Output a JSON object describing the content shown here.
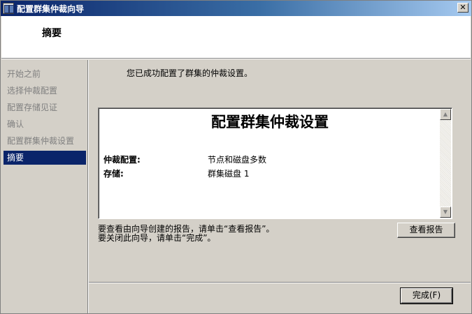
{
  "window": {
    "title": "配置群集仲裁向导",
    "close_glyph": "✕"
  },
  "header": {
    "title": "摘要"
  },
  "sidebar": {
    "items": [
      {
        "label": "开始之前",
        "active": false
      },
      {
        "label": "选择仲裁配置",
        "active": false
      },
      {
        "label": "配置存储见证",
        "active": false
      },
      {
        "label": "确认",
        "active": false
      },
      {
        "label": "配置群集仲裁设置",
        "active": false
      },
      {
        "label": "摘要",
        "active": true
      }
    ]
  },
  "main": {
    "intro": "您已成功配置了群集的仲裁设置。",
    "report": {
      "title": "配置群集仲裁设置",
      "rows": [
        {
          "label": "仲裁配置:",
          "value": "节点和磁盘多数"
        },
        {
          "label": "存储:",
          "value": "群集磁盘 1"
        }
      ]
    },
    "hint_line1": "要查看由向导创建的报告，请单击“查看报告”。",
    "hint_line2": "要关闭此向导，请单击“完成”。",
    "view_report_button": "查看报告",
    "finish_button": "完成(F)"
  },
  "icons": {
    "scroll_up": "▲",
    "scroll_down": "▼"
  }
}
